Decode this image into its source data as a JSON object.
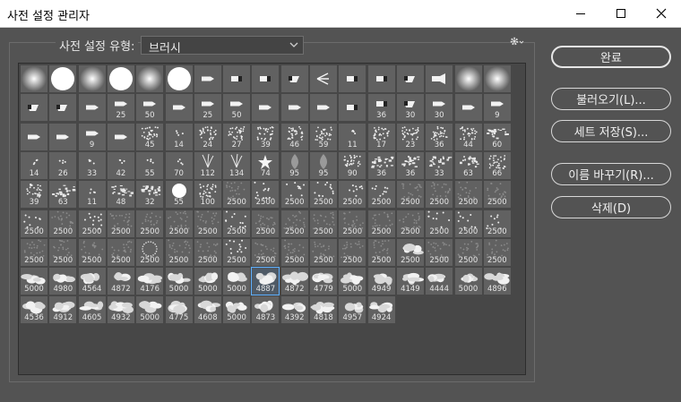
{
  "window": {
    "title": "사전 설정 관리자"
  },
  "preset": {
    "label": "사전 설정 유형:",
    "type_value": "브러시"
  },
  "buttons": {
    "done": "완료",
    "load": "불러오기(L)...",
    "save_set": "세트 저장(S)...",
    "rename": "이름 바꾸기(R)...",
    "delete": "삭제(D)"
  },
  "brushes": [
    {
      "label": "",
      "kind": "soft"
    },
    {
      "label": "",
      "kind": "hard"
    },
    {
      "label": "",
      "kind": "soft"
    },
    {
      "label": "",
      "kind": "hard"
    },
    {
      "label": "",
      "kind": "soft"
    },
    {
      "label": "",
      "kind": "hard"
    },
    {
      "label": "",
      "kind": "pencil"
    },
    {
      "label": "",
      "kind": "marker"
    },
    {
      "label": "",
      "kind": "marker"
    },
    {
      "label": "",
      "kind": "chisel"
    },
    {
      "label": "",
      "kind": "fan"
    },
    {
      "label": "",
      "kind": "marker"
    },
    {
      "label": "",
      "kind": "marker"
    },
    {
      "label": "",
      "kind": "chisel"
    },
    {
      "label": "",
      "kind": "airbrush"
    },
    {
      "label": "",
      "kind": "soft"
    },
    {
      "label": "",
      "kind": "soft"
    },
    {
      "label": "",
      "kind": "chisel"
    },
    {
      "label": "",
      "kind": "chisel"
    },
    {
      "label": "",
      "kind": "pencil"
    },
    {
      "label": "25",
      "kind": "pencil"
    },
    {
      "label": "50",
      "kind": "pencil"
    },
    {
      "label": "",
      "kind": "pencil"
    },
    {
      "label": "25",
      "kind": "pencil"
    },
    {
      "label": "50",
      "kind": "pencil"
    },
    {
      "label": "",
      "kind": "pencil"
    },
    {
      "label": "",
      "kind": "pencil"
    },
    {
      "label": "",
      "kind": "pencil"
    },
    {
      "label": "",
      "kind": "marker"
    },
    {
      "label": "36",
      "kind": "marker"
    },
    {
      "label": "30",
      "kind": "chisel"
    },
    {
      "label": "30",
      "kind": "pencil"
    },
    {
      "label": "",
      "kind": "pencil"
    },
    {
      "label": "9",
      "kind": "pencil"
    },
    {
      "label": "",
      "kind": "pencil"
    },
    {
      "label": "",
      "kind": "pencil"
    },
    {
      "label": "9",
      "kind": "pencil"
    },
    {
      "label": "",
      "kind": "pencil"
    },
    {
      "label": "45",
      "kind": "splat"
    },
    {
      "label": "14",
      "kind": "speck"
    },
    {
      "label": "24",
      "kind": "splat"
    },
    {
      "label": "27",
      "kind": "splat"
    },
    {
      "label": "39",
      "kind": "splat"
    },
    {
      "label": "46",
      "kind": "splat"
    },
    {
      "label": "59",
      "kind": "splat"
    },
    {
      "label": "11",
      "kind": "speck"
    },
    {
      "label": "17",
      "kind": "splat"
    },
    {
      "label": "23",
      "kind": "splat"
    },
    {
      "label": "36",
      "kind": "splat"
    },
    {
      "label": "44",
      "kind": "splat"
    },
    {
      "label": "60",
      "kind": "texture"
    },
    {
      "label": "14",
      "kind": "speck"
    },
    {
      "label": "26",
      "kind": "speck"
    },
    {
      "label": "33",
      "kind": "speck"
    },
    {
      "label": "42",
      "kind": "speck"
    },
    {
      "label": "55",
      "kind": "speck"
    },
    {
      "label": "70",
      "kind": "speck"
    },
    {
      "label": "112",
      "kind": "grass"
    },
    {
      "label": "134",
      "kind": "grass"
    },
    {
      "label": "74",
      "kind": "star"
    },
    {
      "label": "95",
      "kind": "leaf"
    },
    {
      "label": "95",
      "kind": "leaf"
    },
    {
      "label": "90",
      "kind": "splat"
    },
    {
      "label": "36",
      "kind": "texture"
    },
    {
      "label": "36",
      "kind": "texture"
    },
    {
      "label": "33",
      "kind": "texture"
    },
    {
      "label": "63",
      "kind": "texture"
    },
    {
      "label": "66",
      "kind": "splat"
    },
    {
      "label": "39",
      "kind": "splat"
    },
    {
      "label": "63",
      "kind": "texture"
    },
    {
      "label": "11",
      "kind": "speck"
    },
    {
      "label": "48",
      "kind": "texture"
    },
    {
      "label": "32",
      "kind": "texture"
    },
    {
      "label": "55",
      "kind": "hard"
    },
    {
      "label": "100",
      "kind": "splat"
    },
    {
      "label": "2500",
      "kind": "faint"
    },
    {
      "label": "2500",
      "kind": "scatter"
    },
    {
      "label": "2500",
      "kind": "dots"
    },
    {
      "label": "2500",
      "kind": "scatter"
    },
    {
      "label": "2500",
      "kind": "dots"
    },
    {
      "label": "2500",
      "kind": "dots"
    },
    {
      "label": "2500",
      "kind": "faint"
    },
    {
      "label": "2500",
      "kind": "faint"
    },
    {
      "label": "2500",
      "kind": "faint"
    },
    {
      "label": "2500",
      "kind": "faint"
    },
    {
      "label": "2500",
      "kind": "dots"
    },
    {
      "label": "2500",
      "kind": "faint"
    },
    {
      "label": "2500",
      "kind": "scatter"
    },
    {
      "label": "2500",
      "kind": "faint"
    },
    {
      "label": "2500",
      "kind": "faint"
    },
    {
      "label": "2500",
      "kind": "faint"
    },
    {
      "label": "2500",
      "kind": "faint"
    },
    {
      "label": "2500",
      "kind": "scatter"
    },
    {
      "label": "2500",
      "kind": "faint"
    },
    {
      "label": "2500",
      "kind": "faint"
    },
    {
      "label": "2500",
      "kind": "faint"
    },
    {
      "label": "2500",
      "kind": "faint"
    },
    {
      "label": "2500",
      "kind": "faint"
    },
    {
      "label": "2500",
      "kind": "faint"
    },
    {
      "label": "2500",
      "kind": "dots"
    },
    {
      "label": "2500",
      "kind": "dots"
    },
    {
      "label": "2500",
      "kind": "dots"
    },
    {
      "label": "2500",
      "kind": "faint"
    },
    {
      "label": "2500",
      "kind": "faint"
    },
    {
      "label": "2500",
      "kind": "faint"
    },
    {
      "label": "2500",
      "kind": "faint"
    },
    {
      "label": "2500",
      "kind": "ring"
    },
    {
      "label": "2500",
      "kind": "faint"
    },
    {
      "label": "2500",
      "kind": "faint"
    },
    {
      "label": "2500",
      "kind": "scatter"
    },
    {
      "label": "2500",
      "kind": "faint"
    },
    {
      "label": "2500",
      "kind": "faint"
    },
    {
      "label": "2500",
      "kind": "faint"
    },
    {
      "label": "2500",
      "kind": "faint"
    },
    {
      "label": "2500",
      "kind": "faint"
    },
    {
      "label": "2500",
      "kind": "cloud"
    },
    {
      "label": "2500",
      "kind": "faint"
    },
    {
      "label": "2500",
      "kind": "faint"
    },
    {
      "label": "2500",
      "kind": "faint"
    },
    {
      "label": "5000",
      "kind": "cloud"
    },
    {
      "label": "4980",
      "kind": "cloud"
    },
    {
      "label": "4564",
      "kind": "cloud"
    },
    {
      "label": "4872",
      "kind": "cloud"
    },
    {
      "label": "4176",
      "kind": "cloud"
    },
    {
      "label": "5000",
      "kind": "cloud"
    },
    {
      "label": "5000",
      "kind": "cloud"
    },
    {
      "label": "5000",
      "kind": "cloud"
    },
    {
      "label": "4887",
      "kind": "cloud",
      "selected": true
    },
    {
      "label": "4872",
      "kind": "cloud"
    },
    {
      "label": "4779",
      "kind": "cloud"
    },
    {
      "label": "5000",
      "kind": "cloud"
    },
    {
      "label": "4949",
      "kind": "cloud"
    },
    {
      "label": "4149",
      "kind": "cloud"
    },
    {
      "label": "4444",
      "kind": "cloud"
    },
    {
      "label": "5000",
      "kind": "cloud"
    },
    {
      "label": "4896",
      "kind": "cloud"
    },
    {
      "label": "4536",
      "kind": "cloud"
    },
    {
      "label": "4912",
      "kind": "cloud"
    },
    {
      "label": "4605",
      "kind": "cloud"
    },
    {
      "label": "4932",
      "kind": "cloud"
    },
    {
      "label": "5000",
      "kind": "cloud"
    },
    {
      "label": "4775",
      "kind": "cloud"
    },
    {
      "label": "4608",
      "kind": "cloud"
    },
    {
      "label": "5000",
      "kind": "cloud"
    },
    {
      "label": "4873",
      "kind": "cloud"
    },
    {
      "label": "4392",
      "kind": "cloud"
    },
    {
      "label": "4818",
      "kind": "cloud"
    },
    {
      "label": "4957",
      "kind": "cloud"
    },
    {
      "label": "4924",
      "kind": "cloud"
    }
  ]
}
